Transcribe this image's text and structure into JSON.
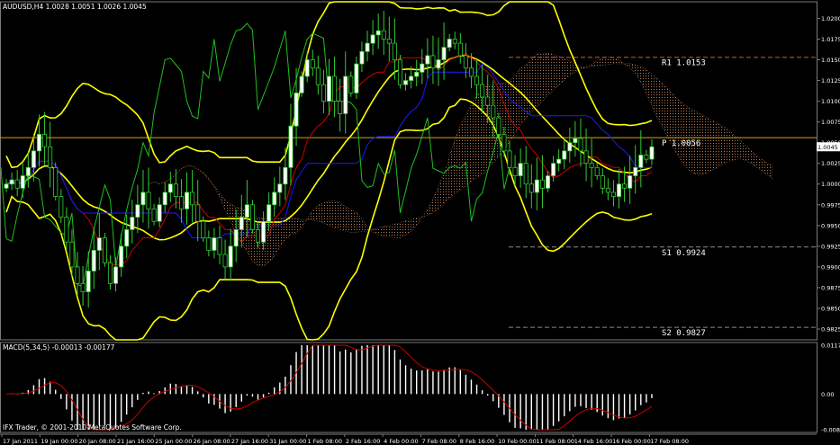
{
  "header": {
    "main_label": "AUDUSD,H4  1.0028 1.0051 1.0026 1.0045",
    "macd_label": "MACD(5,34,5) -0.00013 -0.00177",
    "copyright": "IFX Trader, © 2001-2010 MetaQuotes Software Corp."
  },
  "colors": {
    "background": "#000000",
    "candle": "#32CD32",
    "bull_body": "#ffffff",
    "bollinger": "#ffff00",
    "chikou": "#1fbf1f",
    "tenkan": "#cc0000",
    "kijun": "#1a1aff",
    "kumo": "#c8875a",
    "kumo_alt": "#b8b8b8",
    "pivot_p": "#d9a500",
    "pivot_r1": "#d9532b",
    "pivot_s": "#8c8c8c",
    "macd_hist": "#ffffff",
    "macd_signal": "#cc0000"
  },
  "chart_data": [
    {
      "type": "candlestick",
      "y_ticks": [
        "1.0200",
        "1.0175",
        "1.0150",
        "1.0125",
        "1.0100",
        "1.0075",
        "1.0050",
        "1.0025",
        "1.0000",
        "0.9975",
        "0.9950",
        "0.9925",
        "0.9900",
        "0.9875",
        "0.9850",
        "0.9825"
      ],
      "ylim": [
        0.9812,
        1.022
      ],
      "current_price": "1.0045",
      "x_ticks": [
        "17 Jan 2011",
        "19 Jan 00:00",
        "20 Jan 08:00",
        "21 Jan 16:00",
        "25 Jan 00:00",
        "26 Jan 08:00",
        "27 Jan 16:00",
        "31 Jan 00:00",
        "1 Feb 08:00",
        "2 Feb 16:00",
        "4 Feb 00:00",
        "7 Feb 08:00",
        "8 Feb 16:00",
        "10 Feb 00:00",
        "11 Feb 08:00",
        "14 Feb 16:00",
        "16 Feb 00:00",
        "17 Feb 08:00"
      ],
      "levels": [
        {
          "name": "R1",
          "value": 1.0153,
          "label": "R1 1.0153"
        },
        {
          "name": "P",
          "value": 1.0056,
          "label": "P 1.0056"
        },
        {
          "name": "S1",
          "value": 0.9924,
          "label": "S1 0.9924"
        },
        {
          "name": "S2",
          "value": 0.9827,
          "label": "S2 0.9827"
        }
      ],
      "close": [
        1.0,
        1.0005,
        0.9995,
        1.001,
        1.002,
        1.004,
        1.006,
        1.0045,
        1.002,
        0.9985,
        0.996,
        0.993,
        0.99,
        0.988,
        0.987,
        0.9895,
        0.992,
        0.9935,
        0.9905,
        0.988,
        0.99,
        0.9925,
        0.9945,
        0.996,
        0.9975,
        0.999,
        0.997,
        0.9955,
        0.9975,
        0.999,
        1.0,
        0.9985,
        0.997,
        0.999,
        0.9975,
        0.9955,
        0.9935,
        0.992,
        0.9935,
        0.9915,
        0.99,
        0.9925,
        0.9945,
        0.996,
        0.9975,
        0.9945,
        0.993,
        0.9955,
        0.9975,
        0.999,
        1.0,
        1.002,
        1.007,
        1.011,
        1.013,
        1.015,
        1.014,
        1.012,
        1.01,
        1.013,
        1.01,
        1.0085,
        1.013,
        1.011,
        1.0145,
        1.016,
        1.017,
        1.018,
        1.0185,
        1.0175,
        1.017,
        1.015,
        1.012,
        1.0125,
        1.013,
        1.0135,
        1.0145,
        1.0155,
        1.014,
        1.015,
        1.0165,
        1.0175,
        1.017,
        1.0155,
        1.014,
        1.013,
        1.012,
        1.0105,
        1.0095,
        1.008,
        1.006,
        1.004,
        1.002,
        1.001,
        1.0025,
        1.0,
        0.999,
        1.0005,
        0.9995,
        1.001,
        1.0025,
        1.003,
        1.004,
        1.005,
        1.0055,
        1.004,
        1.0025,
        1.002,
        1.001,
        0.9995,
        0.999,
        0.9985,
        1.0,
        0.9995,
        1.001,
        1.002,
        1.0035,
        1.003,
        1.0045
      ]
    },
    {
      "type": "bar",
      "name": "MACD(5,34,5)",
      "y_ticks": [
        "0.01179",
        "0.00",
        "-0.00861"
      ],
      "ylim": [
        -0.00861,
        0.01179
      ]
    }
  ]
}
